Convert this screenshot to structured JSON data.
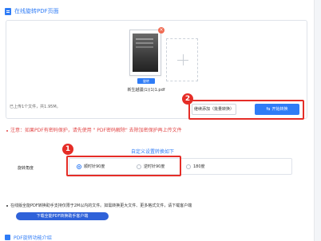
{
  "header": {
    "title": "在线旋转PDF页面",
    "icon": "document-icon"
  },
  "file": {
    "name": "新生越疆(1)(1)1.pdf",
    "rotate_label": "旋转",
    "close_glyph": "×"
  },
  "upload": {
    "info": "已上传1个文件，共1.95M。",
    "add_glyph": "+"
  },
  "buttons": {
    "continue_add": "继续添加（批量转换）",
    "start": "开始转换",
    "start_icon": "⇆"
  },
  "annotations": {
    "badge_1": "1",
    "badge_2": "2"
  },
  "notice": "注意：如果PDF有密码保护，请先使用 \" PDF密码解除\" 去除加密保护再上传文件",
  "settings": {
    "custom_link": "自定义设置转换如下",
    "rotation_label": "旋转角度",
    "options": [
      {
        "label": "顺时针90度",
        "checked": true
      },
      {
        "label": "逆时针90度",
        "checked": false
      },
      {
        "label": "180度",
        "checked": false
      }
    ]
  },
  "info": {
    "text": "在线版全能PDF转换助手支持仅限于2M以内的文件。如需转换更大文件、更多格式文件，请下载客户端",
    "download_button": "下载全能PDF转换助手客户端"
  },
  "footer": {
    "title": "PDF旋转功能介绍"
  },
  "colors": {
    "accent": "#2f7cf6",
    "annotation": "#e52d27",
    "warning": "#e24848"
  }
}
